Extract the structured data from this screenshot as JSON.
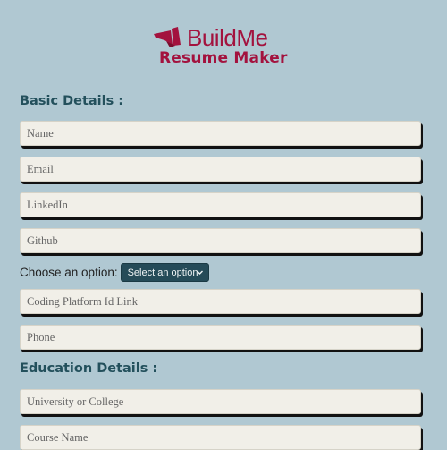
{
  "brand": {
    "name": "BuildMe",
    "tagline": "Resume Maker"
  },
  "sections": {
    "basic": "Basic Details :",
    "education": "Education Details :"
  },
  "fields": {
    "name": "Name",
    "email": "Email",
    "linkedin": "LinkedIn",
    "github": "Github",
    "coding": "Coding Platform Id Link",
    "phone": "Phone",
    "university": "University or College",
    "course": "Course Name"
  },
  "option": {
    "label": "Choose an option:",
    "selected": "Select an option"
  },
  "colors": {
    "background": "#b0c8d2",
    "brand": "#a3123e",
    "heading": "#23505c",
    "select_bg": "#254b58",
    "field_bg": "#f1efe8"
  }
}
